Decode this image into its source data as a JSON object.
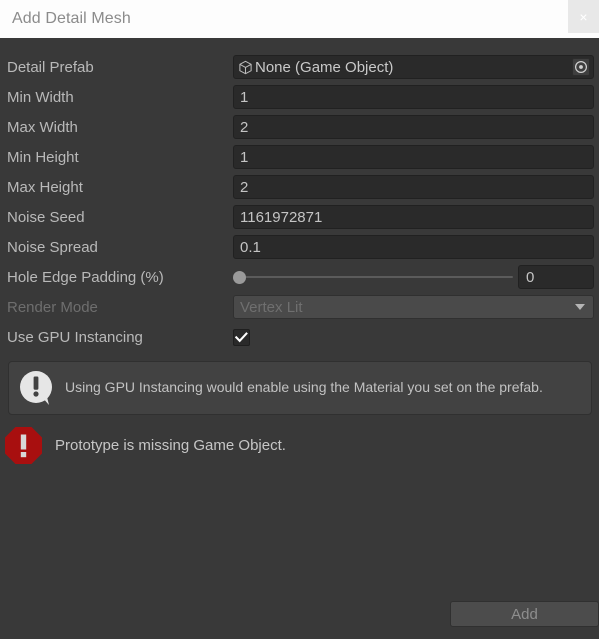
{
  "window": {
    "title": "Add Detail Mesh",
    "close_label": "×"
  },
  "form": {
    "detail_prefab": {
      "label": "Detail Prefab",
      "value": "None (Game Object)",
      "icon": "cube-icon",
      "picker_icon": "target-picker-icon"
    },
    "min_width": {
      "label": "Min Width",
      "value": "1"
    },
    "max_width": {
      "label": "Max Width",
      "value": "2"
    },
    "min_height": {
      "label": "Min Height",
      "value": "1"
    },
    "max_height": {
      "label": "Max Height",
      "value": "2"
    },
    "noise_seed": {
      "label": "Noise Seed",
      "value": "1161972871"
    },
    "noise_spread": {
      "label": "Noise Spread",
      "value": "0.1"
    },
    "hole_edge_padding": {
      "label": "Hole Edge Padding (%)",
      "value": "0",
      "slider_percent": 0
    },
    "render_mode": {
      "label": "Render Mode",
      "value": "Vertex Lit",
      "disabled": true,
      "caret_icon": "chevron-down-icon"
    },
    "use_gpu_instancing": {
      "label": "Use GPU Instancing",
      "checked": true,
      "check_icon": "checkmark-icon"
    }
  },
  "help": {
    "icon": "info-bubble-icon",
    "text": "Using GPU Instancing would enable using the Material you set on the prefab."
  },
  "error": {
    "icon": "error-octagon-icon",
    "text": "Prototype is missing Game Object."
  },
  "footer": {
    "add_label": "Add"
  },
  "colors": {
    "window_bg": "#393939",
    "titlebar_bg": "#fdfdfd",
    "field_bg": "#2a2a2a",
    "label_text": "#b9b9b9",
    "disabled_text": "#6e6e6e",
    "error_red": "#a80f0f",
    "helpbox_bg": "#424242"
  }
}
